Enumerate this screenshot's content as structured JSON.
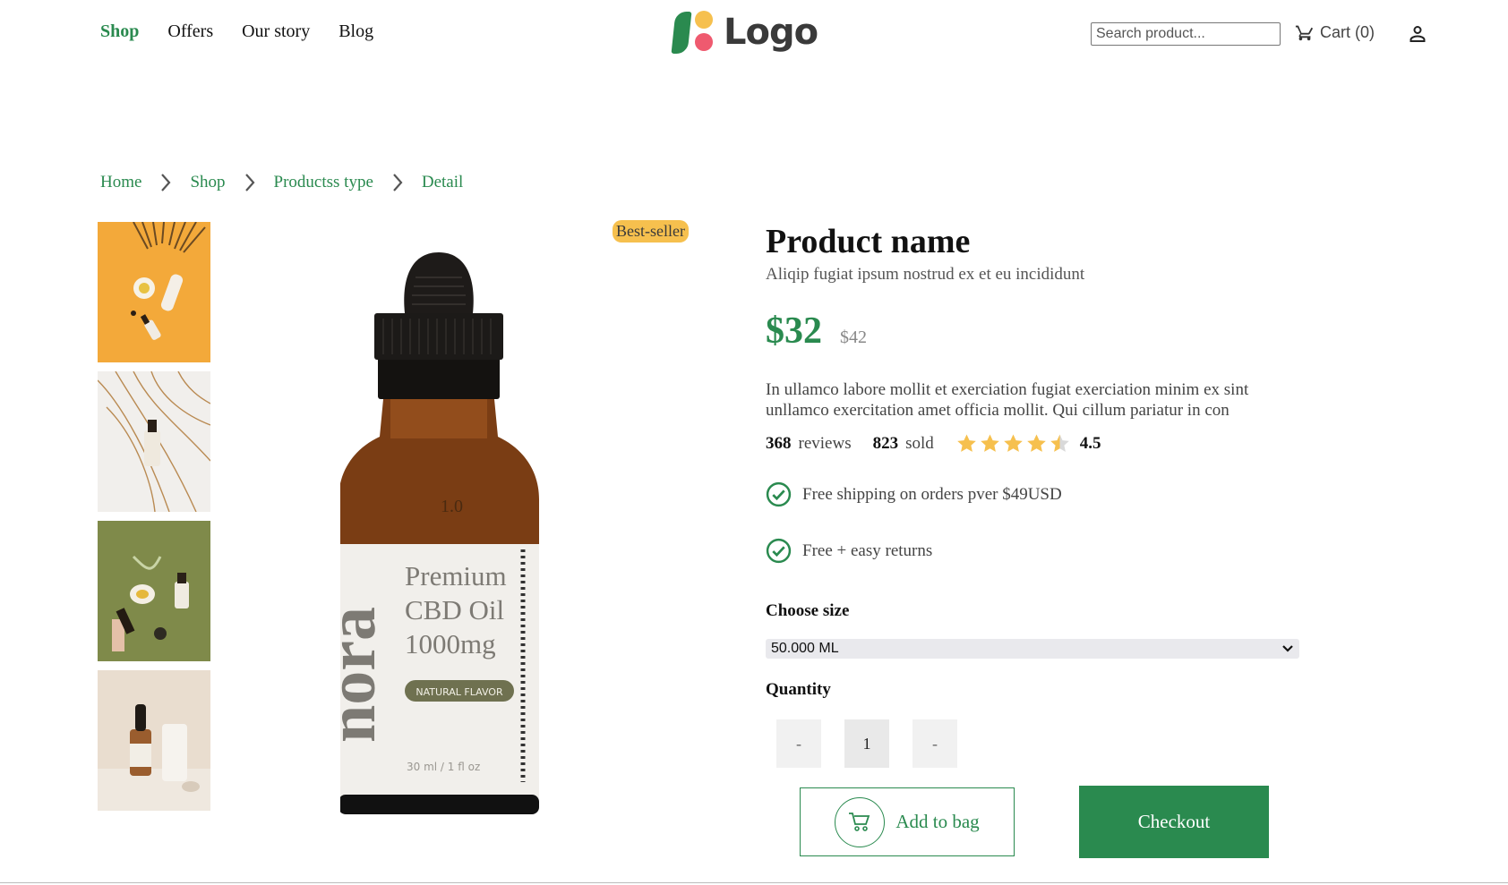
{
  "nav": {
    "items": [
      {
        "label": "Shop",
        "active": true
      },
      {
        "label": "Offers",
        "active": false
      },
      {
        "label": "Our story",
        "active": false
      },
      {
        "label": "Blog",
        "active": false
      }
    ]
  },
  "logo": {
    "text": "Logo"
  },
  "search": {
    "placeholder": "Search product..."
  },
  "cart": {
    "label": "Cart (0)"
  },
  "breadcrumb": [
    "Home",
    "Shop",
    "Productss type",
    "Detail"
  ],
  "badge": "Best-seller",
  "product": {
    "name": "Product name",
    "subtitle": "Aliqip fugiat ipsum nostrud ex et eu incididunt",
    "price": "$32",
    "old_price": "$42",
    "description": "In ullamco labore mollit et exerciation fugiat exerciation minim ex sint unllamco exercitation amet officia mollit. Qui cillum pariatur in con",
    "reviews_count": "368",
    "reviews_label": "reviews",
    "sold_count": "823",
    "sold_label": "sold",
    "rating": "4.5",
    "rating_value": 4.5,
    "perks": [
      "Free shipping on orders pver $49USD",
      "Free + easy returns"
    ],
    "size_label": "Choose size",
    "size_selected": "50.000 ML",
    "quantity_label": "Quantity",
    "quantity": "1",
    "decrement_label": "-",
    "increment_label": "-",
    "bottle": {
      "brand": "nora",
      "line1": "Premium",
      "line2": "CBD Oil",
      "line3": "1000mg",
      "flavor": "NATURAL FLAVOR",
      "volume": "30 ml / 1 fl oz"
    }
  },
  "actions": {
    "add_to_bag": "Add to bag",
    "checkout": "Checkout"
  },
  "colors": {
    "accent": "#2a8a4f",
    "badge": "#f6c04e",
    "star": "#f6c04e"
  }
}
